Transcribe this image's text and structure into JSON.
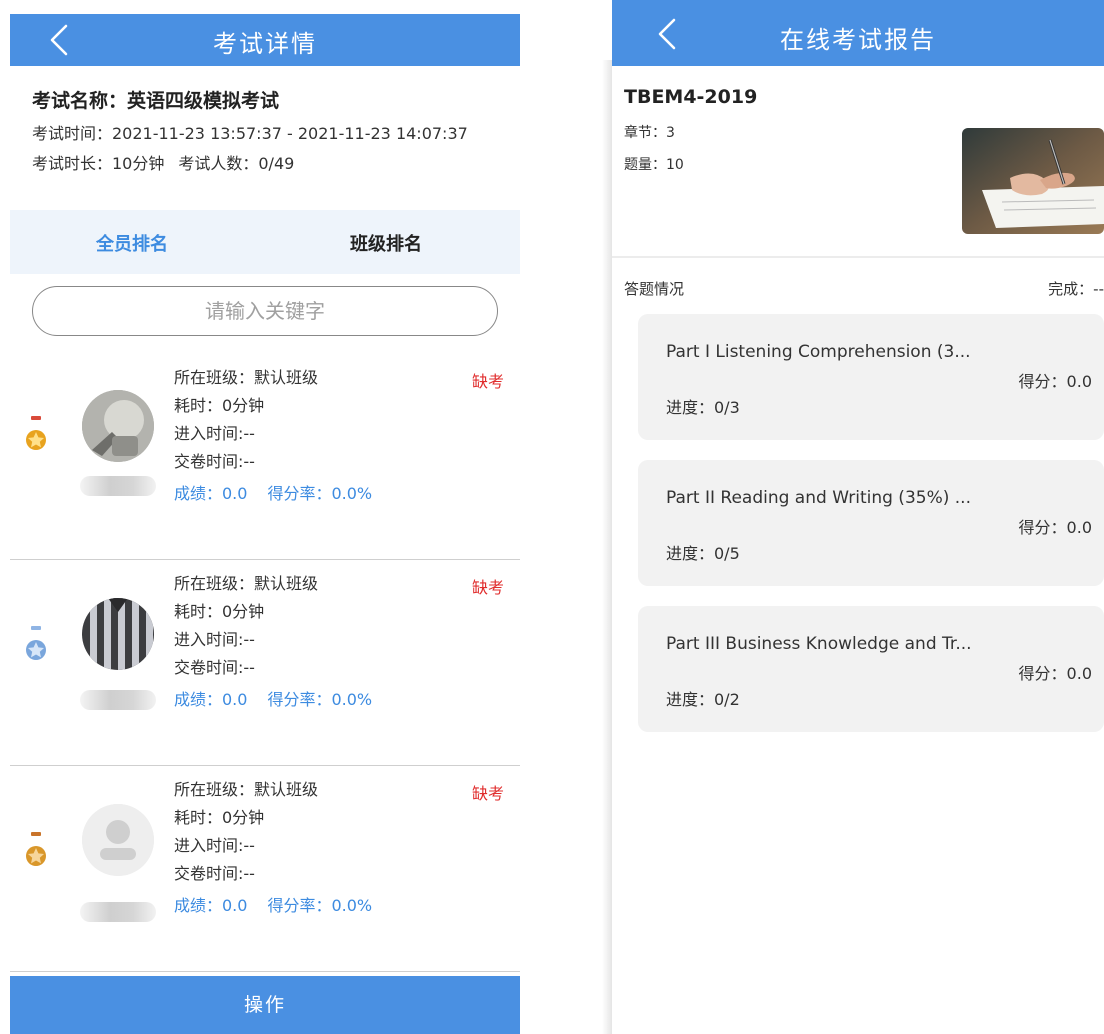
{
  "left": {
    "header_title": "考试详情",
    "exam_name": "考试名称：英语四级模拟考试",
    "exam_time": "考试时间：2021-11-23 13:57:37 - 2021-11-23 14:07:37",
    "duration": "考试时长：10分钟",
    "participants": "考试人数：0/49",
    "tabs": [
      "全员排名",
      "班级排名"
    ],
    "search_placeholder": "请输入关键字",
    "students": [
      {
        "class": "所在班级：默认班级",
        "time_spent": "耗时：0分钟",
        "enter_time": "进入时间:--",
        "submit_time": "交卷时间:--",
        "score": "成绩：0.0",
        "rate": "得分率：0.0%",
        "status": "缺考",
        "medal_color": "#e8a31f"
      },
      {
        "class": "所在班级：默认班级",
        "time_spent": "耗时：0分钟",
        "enter_time": "进入时间:--",
        "submit_time": "交卷时间:--",
        "score": "成绩：0.0",
        "rate": "得分率：0.0%",
        "status": "缺考",
        "medal_color": "#7aa6dc"
      },
      {
        "class": "所在班级：默认班级",
        "time_spent": "耗时：0分钟",
        "enter_time": "进入时间:--",
        "submit_time": "交卷时间:--",
        "score": "成绩：0.0",
        "rate": "得分率：0.0%",
        "status": "缺考",
        "medal_color": "#d9972a"
      }
    ],
    "action_button": "操作",
    "accent_color": "#4a90e2"
  },
  "right": {
    "header_title": "在线考试报告",
    "exam_code": "TBEM4-2019",
    "chapters": "章节：3",
    "questions": "题量：10",
    "answer_section_label": "答题情况",
    "completion_label": "完成：--",
    "parts": [
      {
        "title": "Part I Listening Comprehension (3...",
        "score": "得分：0.0",
        "progress": "进度：0/3"
      },
      {
        "title": "Part II Reading and Writing (35%) ...",
        "score": "得分：0.0",
        "progress": "进度：0/5"
      },
      {
        "title": "Part III Business Knowledge and Tr...",
        "score": "得分：0.0",
        "progress": "进度：0/2"
      }
    ]
  }
}
